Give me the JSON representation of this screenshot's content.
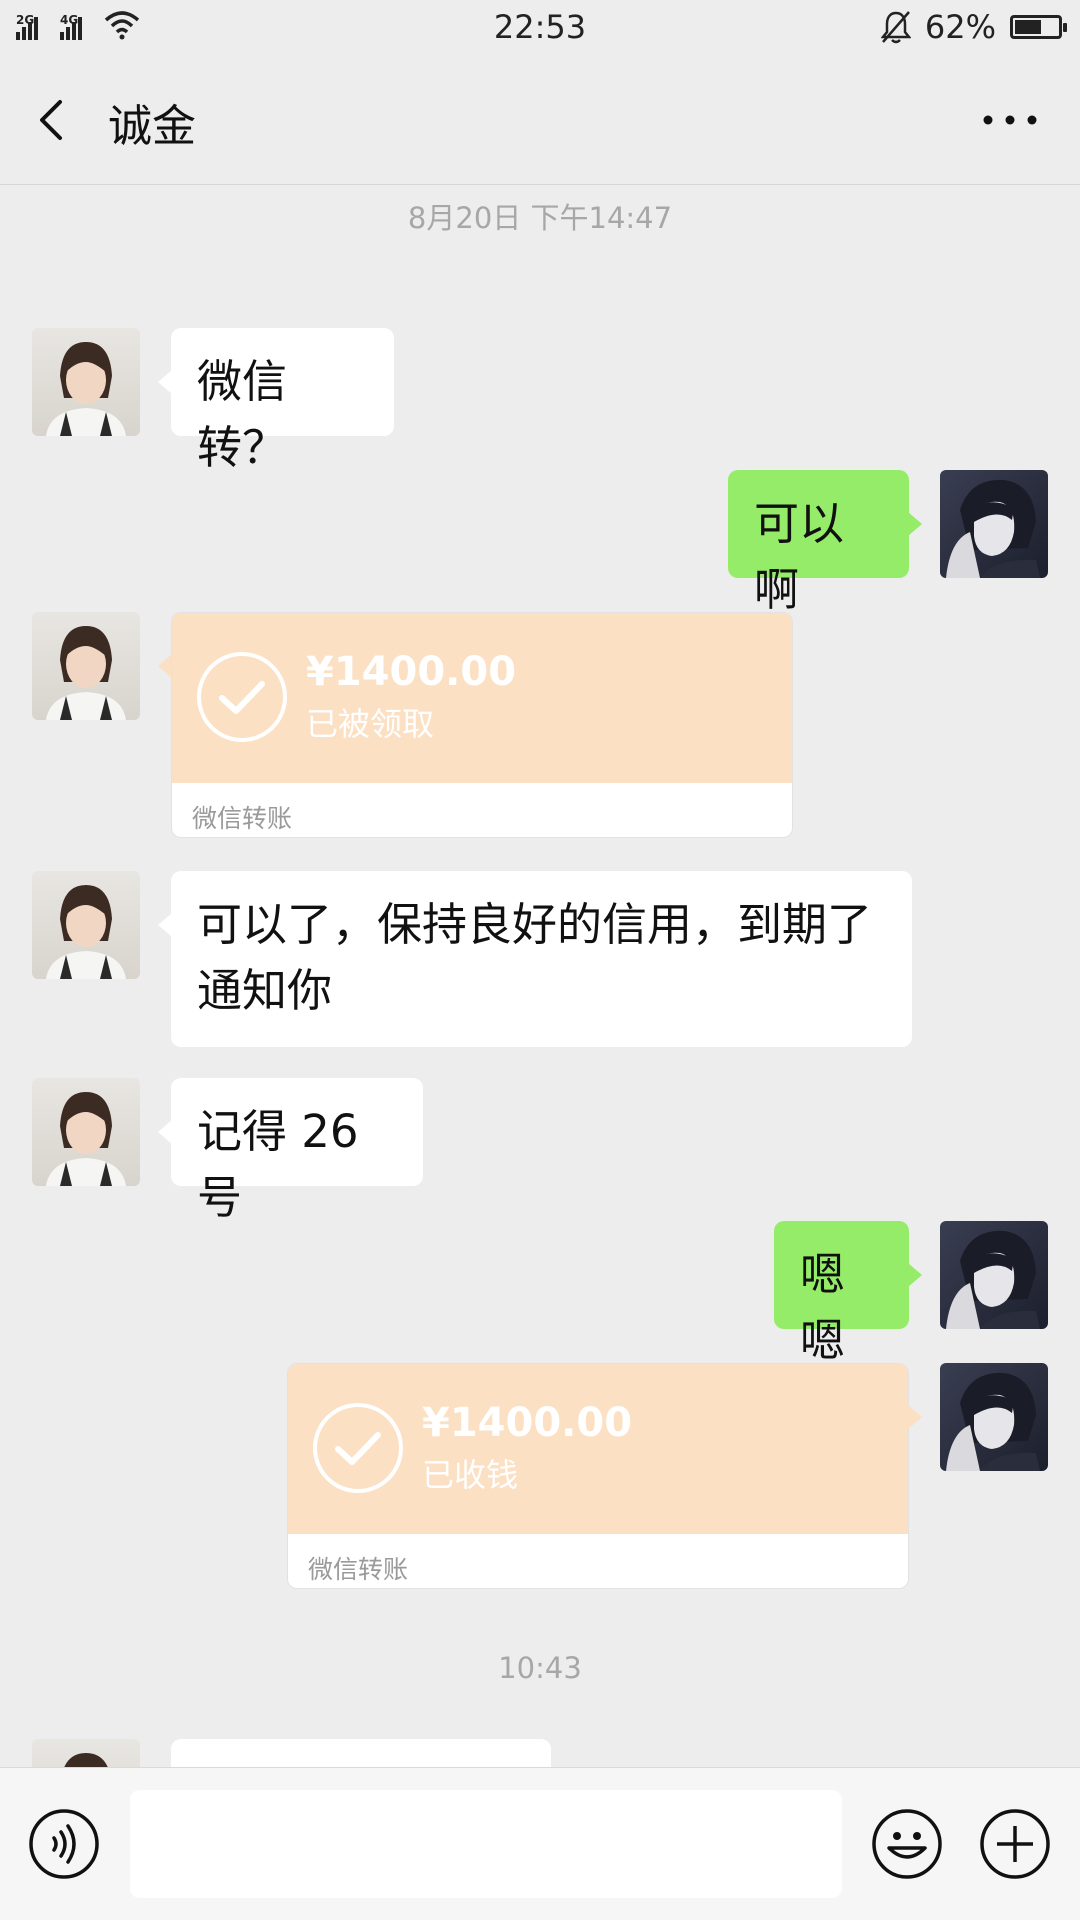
{
  "status_bar": {
    "network_1": "2G",
    "network_2": "4G",
    "time": "22:53",
    "battery_percent": "62%",
    "battery_level": 0.62
  },
  "header": {
    "title": "诚金",
    "back_icon": "chevron-left-icon",
    "more_icon": "more-horizontal-icon"
  },
  "chat": {
    "timestamp_1": "8月20日 下午14:47",
    "msg_1": "微信转？",
    "msg_2": "可以啊",
    "transfer_1": {
      "amount": "¥1400.00",
      "status": "已被领取",
      "label": "微信转账"
    },
    "msg_3_line1": "可以了，保持良好的信用，到期了",
    "msg_3_line2": "通知你",
    "msg_4": "记得 26 号",
    "msg_5": "嗯嗯",
    "transfer_2": {
      "amount": "¥1400.00",
      "status": "已收钱",
      "label": "微信转账"
    },
    "timestamp_2": "10:43"
  },
  "input_bar": {
    "voice_icon": "voice-icon",
    "emoji_icon": "emoji-icon",
    "plus_icon": "plus-icon"
  },
  "colors": {
    "background": "#ededed",
    "bubble_out": "#95ec69",
    "bubble_in": "#ffffff",
    "transfer": "#fbe0c4"
  }
}
